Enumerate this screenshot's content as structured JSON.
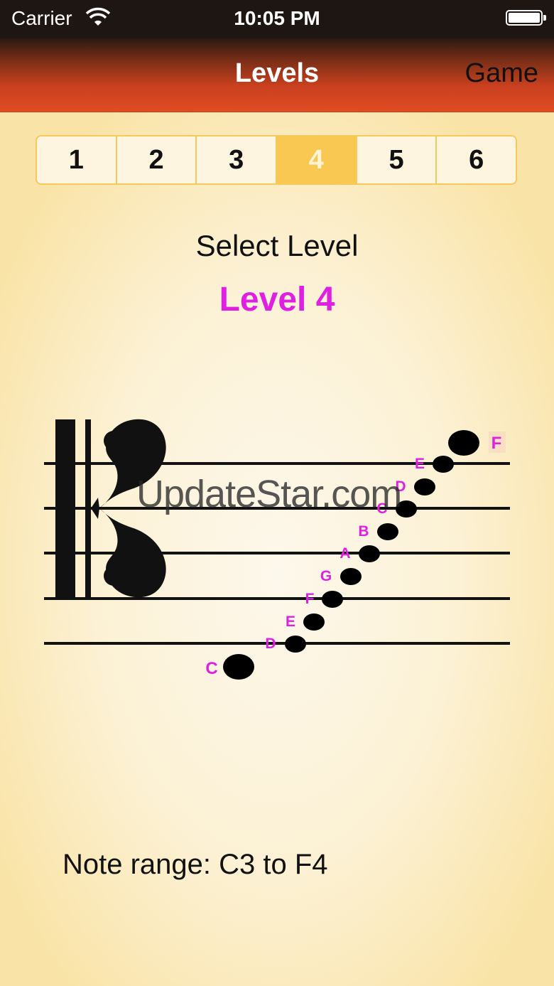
{
  "status_bar": {
    "carrier": "Carrier",
    "time": "10:05 PM"
  },
  "nav_bar": {
    "title": "Levels",
    "right_button": "Game"
  },
  "levels": {
    "segments": [
      "1",
      "2",
      "3",
      "4",
      "5",
      "6"
    ],
    "selected_index": 3
  },
  "select_label": "Select Level",
  "level_title": "Level 4",
  "staff": {
    "clef": "alto-clef",
    "notes": [
      {
        "label": "C",
        "ledger": true
      },
      {
        "label": "D"
      },
      {
        "label": "E"
      },
      {
        "label": "F"
      },
      {
        "label": "G"
      },
      {
        "label": "A"
      },
      {
        "label": "B"
      },
      {
        "label": "C"
      },
      {
        "label": "D"
      },
      {
        "label": "E"
      },
      {
        "label": "F",
        "highlight": true
      }
    ],
    "label_color": "#e020e0"
  },
  "watermark": "UpdateStar.com",
  "note_range": "Note range:  C3 to F4",
  "colors": {
    "accent": "#e020e0",
    "segment_selected": "#f9c852",
    "nav_bottom": "#e04c22"
  }
}
